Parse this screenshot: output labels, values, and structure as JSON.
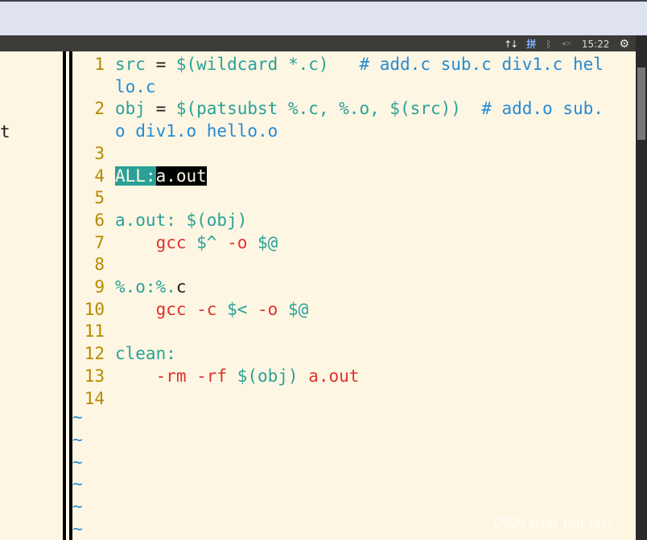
{
  "panel": {
    "network_icon": "network-arrows-icon",
    "keyboard_label": "拼",
    "bluetooth_icon": "bluetooth-icon",
    "volume_icon": "volume-icon",
    "clock": "15:22",
    "settings_icon": "gear-icon"
  },
  "left_pane": {
    "fragment": "t"
  },
  "editor": {
    "lines": [
      {
        "num": "1",
        "segments": [
          {
            "text": "src",
            "color": "cyan"
          },
          {
            "text": " = ",
            "color": "black"
          },
          {
            "text": "$(wildcard *.c)",
            "color": "cyan"
          },
          {
            "text": "   ",
            "color": "black"
          },
          {
            "text": "# add.c sub.c div1.c hel",
            "color": "blue"
          }
        ]
      },
      {
        "num": "",
        "segments": [
          {
            "text": "lo.c",
            "color": "blue"
          }
        ]
      },
      {
        "num": "2",
        "segments": [
          {
            "text": "obj",
            "color": "cyan"
          },
          {
            "text": " = ",
            "color": "black"
          },
          {
            "text": "$(patsubst %.c, %.o, $(src))",
            "color": "cyan"
          },
          {
            "text": "  ",
            "color": "black"
          },
          {
            "text": "# add.o sub.",
            "color": "blue"
          }
        ]
      },
      {
        "num": "",
        "segments": [
          {
            "text": "o div1.o hello.o",
            "color": "blue"
          }
        ]
      },
      {
        "num": "3",
        "segments": []
      },
      {
        "num": "4",
        "segments": [
          {
            "text": "ALL:",
            "color": "hl-teal"
          },
          {
            "text": "a.out",
            "color": "hl-black"
          }
        ]
      },
      {
        "num": "5",
        "segments": []
      },
      {
        "num": "6",
        "segments": [
          {
            "text": "a.out: $(obj)",
            "color": "cyan"
          }
        ]
      },
      {
        "num": "7",
        "segments": [
          {
            "text": "    gcc ",
            "color": "red"
          },
          {
            "text": "$^",
            "color": "cyan"
          },
          {
            "text": " -o ",
            "color": "red"
          },
          {
            "text": "$@",
            "color": "cyan"
          }
        ]
      },
      {
        "num": "8",
        "segments": []
      },
      {
        "num": "9",
        "segments": [
          {
            "text": "%.o:%.",
            "color": "cyan"
          },
          {
            "text": "c",
            "color": "black"
          }
        ]
      },
      {
        "num": "10",
        "segments": [
          {
            "text": "    gcc -c ",
            "color": "red"
          },
          {
            "text": "$<",
            "color": "cyan"
          },
          {
            "text": " -o ",
            "color": "red"
          },
          {
            "text": "$@",
            "color": "cyan"
          }
        ]
      },
      {
        "num": "11",
        "segments": []
      },
      {
        "num": "12",
        "segments": [
          {
            "text": "clean:",
            "color": "cyan"
          }
        ]
      },
      {
        "num": "13",
        "segments": [
          {
            "text": "    -rm -rf ",
            "color": "red"
          },
          {
            "text": "$(obj)",
            "color": "cyan"
          },
          {
            "text": " a.out",
            "color": "red"
          }
        ]
      },
      {
        "num": "14",
        "segments": []
      }
    ],
    "empty_marker": "~",
    "empty_marker_count": 6
  },
  "watermark": "CSDN @cat_fish_rain"
}
